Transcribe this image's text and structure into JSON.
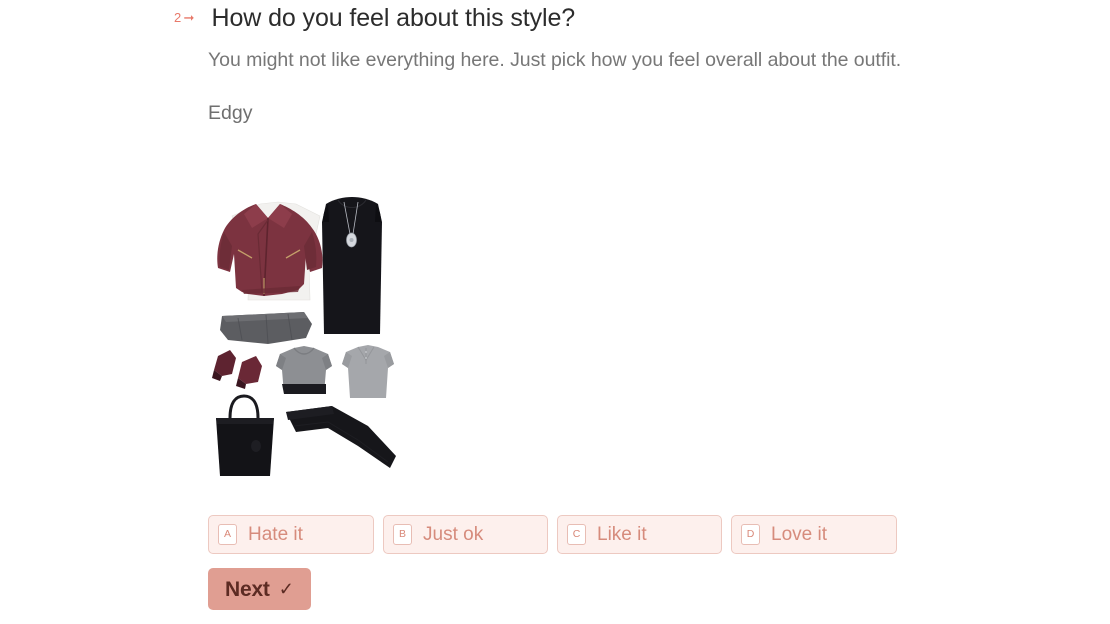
{
  "question": {
    "number": "2",
    "arrow_icon": "arrow-right-icon",
    "title": "How do you feel about this style?",
    "description": "You might not like everything here. Just pick how you feel overall about the outfit.",
    "category_label": "Edgy"
  },
  "outfit_image": {
    "alt": "Edgy outfit flat lay",
    "items": [
      "burgundy leather moto jacket",
      "white t-shirt",
      "black sleeveless dress",
      "silver pendant necklace",
      "gray jeans",
      "burgundy suede ankle boots",
      "gray crewneck sweater",
      "gray henley shirt",
      "black leather tote bag",
      "black trousers"
    ]
  },
  "options": [
    {
      "key": "A",
      "label": "Hate it"
    },
    {
      "key": "B",
      "label": "Just ok"
    },
    {
      "key": "C",
      "label": "Like it"
    },
    {
      "key": "D",
      "label": "Love it"
    }
  ],
  "next_button": {
    "label": "Next",
    "check_icon": "✓"
  },
  "colors": {
    "accent": "#e8796a",
    "option_fill": "#fdf0ed",
    "option_border": "#edc9c1",
    "option_text": "#d68b7c",
    "next_bg": "#e09e92",
    "next_text": "#5c2b23",
    "title_text": "#2c2c2c",
    "body_text": "#777777",
    "background": "#ffffff"
  }
}
